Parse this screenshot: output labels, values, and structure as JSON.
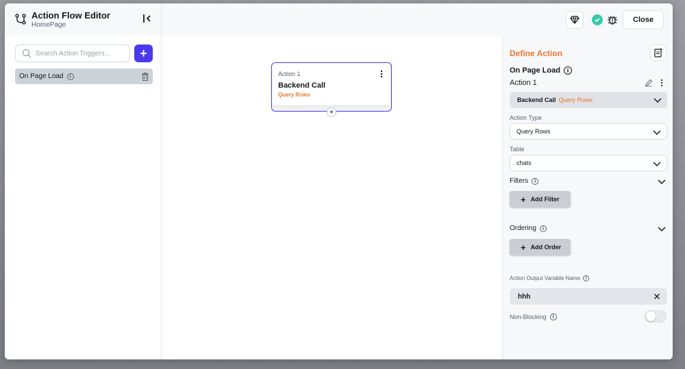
{
  "header": {
    "title": "Action Flow Editor",
    "subtitle": "HomePage",
    "close_label": "Close"
  },
  "left_panel": {
    "search_placeholder": "Search Action Triggers...",
    "add_label": "+",
    "triggers": [
      {
        "label": "On Page Load"
      }
    ]
  },
  "canvas": {
    "node": {
      "label": "Action 1",
      "title": "Backend Call",
      "subtitle": "Query Rows",
      "add_symbol": "+"
    }
  },
  "right_panel": {
    "title": "Define Action",
    "trigger_name": "On Page Load",
    "action_name": "Action 1",
    "action_select": {
      "main": "Backend Call",
      "sub": "Query Rows"
    },
    "action_type": {
      "label": "Action Type",
      "value": "Query Rows"
    },
    "table": {
      "label": "Table",
      "value": "chats"
    },
    "filters": {
      "label": "Filters",
      "button": "Add Filter"
    },
    "ordering": {
      "label": "Ordering",
      "button": "Add Order"
    },
    "output_var": {
      "label": "Action Output Variable Name",
      "value": "hhh"
    },
    "non_blocking": {
      "label": "Non-Blocking",
      "enabled": false
    }
  },
  "colors": {
    "accent": "#4b39ef",
    "orange": "#e8772e",
    "success": "#39c9a8"
  }
}
